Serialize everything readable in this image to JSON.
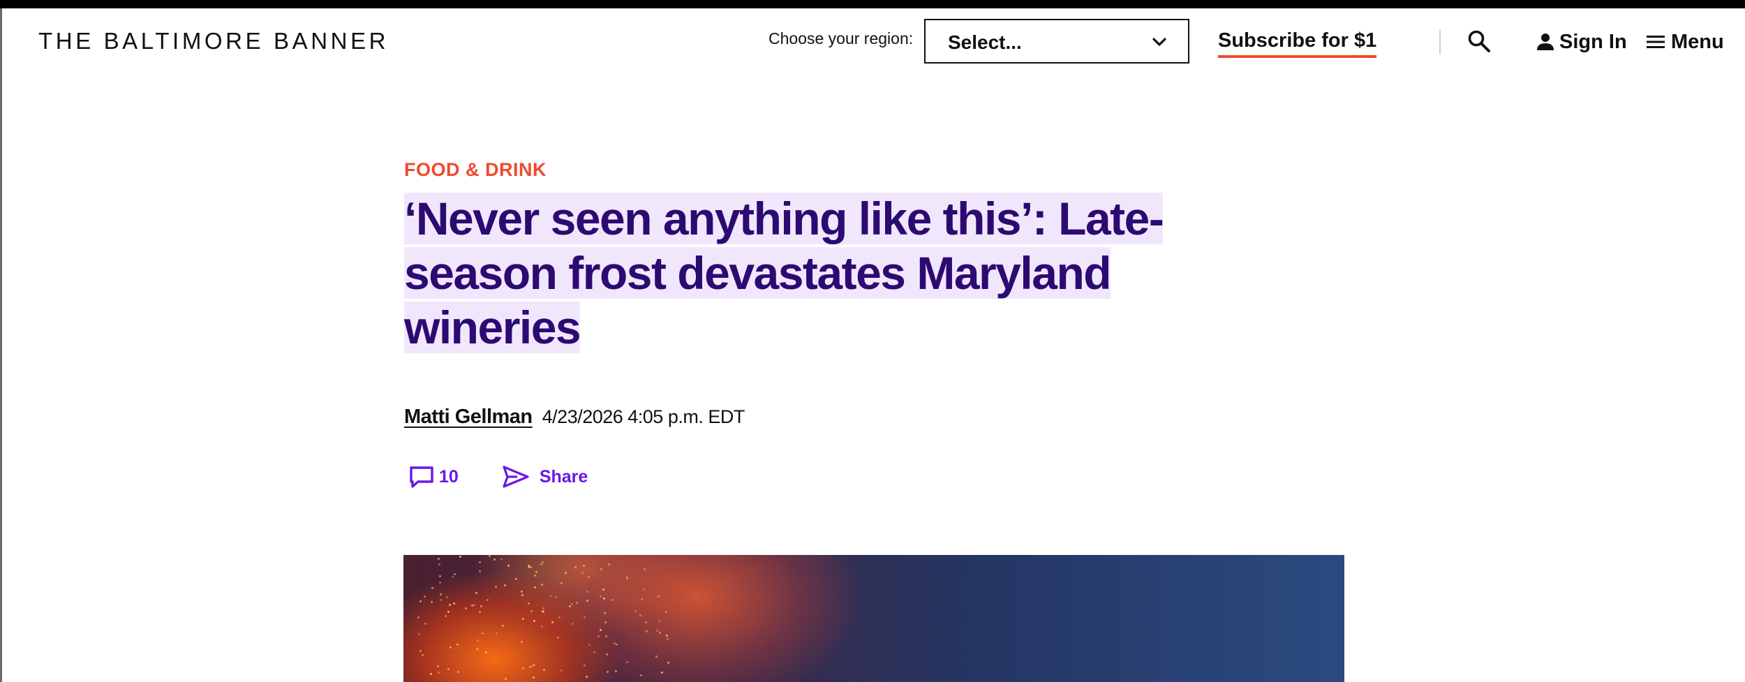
{
  "header": {
    "logo": "THE BALTIMORE BANNER",
    "region_label": "Choose your region:",
    "region_select_value": "Select...",
    "subscribe_label": "Subscribe for $1",
    "signin_label": "Sign In",
    "menu_label": "Menu",
    "icons": [
      "chevron-down-icon",
      "search-icon",
      "person-icon",
      "hamburger-icon"
    ]
  },
  "article": {
    "section": "FOOD & DRINK",
    "headline": "‘Never seen anything like this’: Late-season frost devastates Maryland wineries",
    "author": "Matti Gellman",
    "timestamp": "4/23/2026 4:05 p.m. EDT",
    "comment_count": "10",
    "share_label": "Share",
    "icons": [
      "comment-icon",
      "send-icon"
    ]
  },
  "colors": {
    "accent_red": "#ef4a2b",
    "headline_purple": "#2d0a72",
    "headline_highlight": "#f1e7fd",
    "action_purple": "#6a16e6"
  }
}
